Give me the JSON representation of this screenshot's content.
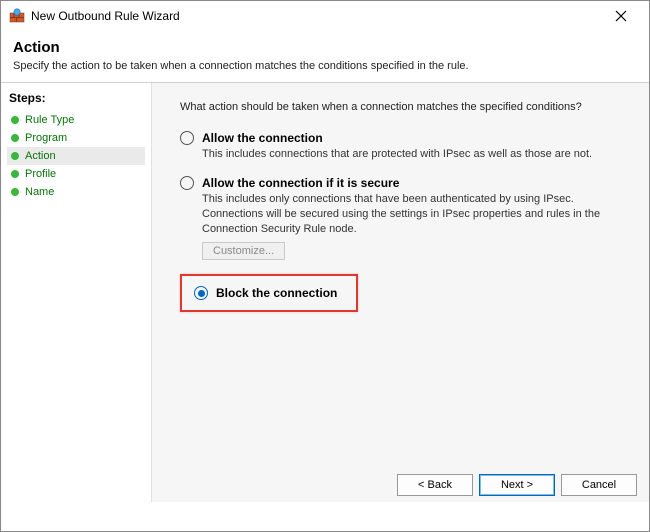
{
  "window": {
    "title": "New Outbound Rule Wizard"
  },
  "header": {
    "title": "Action",
    "subtitle": "Specify the action to be taken when a connection matches the conditions specified in the rule."
  },
  "sidebar": {
    "steps_label": "Steps:",
    "items": [
      {
        "label": "Rule Type"
      },
      {
        "label": "Program"
      },
      {
        "label": "Action"
      },
      {
        "label": "Profile"
      },
      {
        "label": "Name"
      }
    ],
    "active_index": 2
  },
  "main": {
    "question": "What action should be taken when a connection matches the specified conditions?",
    "options": {
      "allow": {
        "label": "Allow the connection",
        "desc": "This includes connections that are protected with IPsec as well as those are not."
      },
      "allow_secure": {
        "label": "Allow the connection if it is secure",
        "desc": "This includes only connections that have been authenticated by using IPsec.  Connections will be secured using the settings in IPsec properties and rules in the Connection Security Rule node.",
        "customize_label": "Customize..."
      },
      "block": {
        "label": "Block the connection"
      }
    },
    "selected": "block"
  },
  "footer": {
    "back": "< Back",
    "next": "Next >",
    "cancel": "Cancel"
  }
}
